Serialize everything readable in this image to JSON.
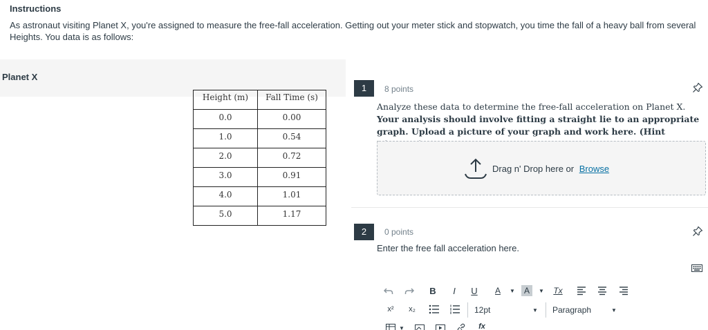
{
  "instructions": {
    "title": "Instructions",
    "body": "As astronaut visiting Planet X, you're assigned to measure the free-fall acceleration. Getting out your meter stick and stopwatch, you time the fall of a heavy ball from several Heights. You data is as follows:"
  },
  "stimulus": {
    "title": "Planet X",
    "table": {
      "headers": [
        "Height (m)",
        "Fall Time (s)"
      ],
      "rows": [
        [
          "0.0",
          "0.00"
        ],
        [
          "1.0",
          "0.54"
        ],
        [
          "2.0",
          "0.72"
        ],
        [
          "3.0",
          "0.91"
        ],
        [
          "4.0",
          "1.01"
        ],
        [
          "5.0",
          "1.17"
        ]
      ]
    }
  },
  "questions": [
    {
      "number": "1",
      "points": "8 points",
      "prompt_plain": "Analyze these data to determine the free-fall acceleration on Planet X. ",
      "prompt_bold": "Your analysis should involve fitting a straight lie to an appropriate graph. Upload a picture of your graph and work here. (Hint Kinematics)",
      "upload": {
        "text": "Drag n' Drop here or",
        "link": "Browse"
      }
    },
    {
      "number": "2",
      "points": "0 points",
      "prompt": "Enter the free fall acceleration here."
    }
  ],
  "editor_toolbar": {
    "bold": "B",
    "italic": "I",
    "underline": "U",
    "font_color": "A",
    "bg_color": "A",
    "clear_format": "Tx",
    "superscript": "x²",
    "subscript": "x₂",
    "font_size": "12pt",
    "block_format": "Paragraph",
    "function": "fx"
  },
  "icons": {
    "undo": "undo-icon",
    "redo": "redo-icon",
    "pin": "pin-icon",
    "upload": "upload-icon",
    "keyboard": "keyboard-icon"
  }
}
